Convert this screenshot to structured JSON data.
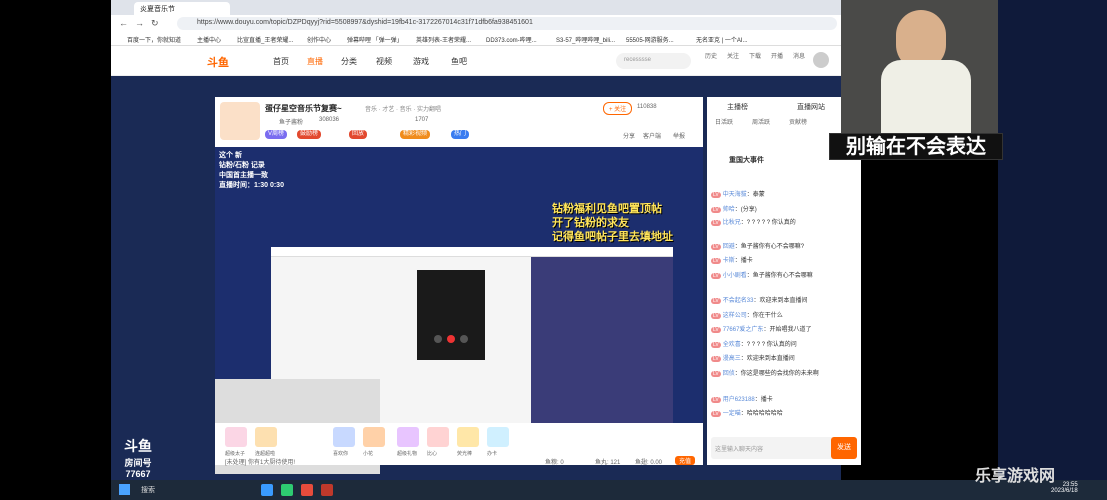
{
  "browser": {
    "tab_title": "炎夏音乐节",
    "url": "https://www.douyu.com/topic/DZPDqyyj?rid=5508997&dyshid=19fb41c-3172267014c31f71dfb6fa938451601",
    "bookmarks": [
      "百度一下，你就知道",
      "主播中心",
      "比宣直播_王者荣耀...",
      "创作中心",
      "弹幕哔哩 「弹一弹」",
      "英雄列表-王者荣耀...",
      "DD373.com-哔哩...",
      "S3-57_哔哩哔哩_bili...",
      "55505-网游服务...",
      "无名亚克 | 一个AI..."
    ]
  },
  "site": {
    "logo": "斗鱼",
    "nav": [
      "首页",
      "直播",
      "分类",
      "视频",
      "游戏",
      "鱼吧"
    ],
    "search_placeholder": "recesssse",
    "header_icons": [
      "历史",
      "关注",
      "下载",
      "开播",
      "消息"
    ]
  },
  "room": {
    "title": "蛋仔星空音乐节复赛~",
    "category": "音乐 · 才艺 · 音乐 · 实力翻唱",
    "follow_label": "+ 关注",
    "followers": "110838",
    "host_name": "鱼子酱粉",
    "hot": "308036",
    "id_label": "1707",
    "badges": [
      "V周榜",
      "鼓励榜",
      "回放",
      "精彩视频",
      "热门"
    ],
    "actions": [
      "分享",
      "客户端",
      "举报"
    ],
    "overlay_text": [
      "钻粉福利见鱼吧置顶帖",
      "开了钻粉的求友",
      "记得鱼吧帖子里去填地址"
    ],
    "left_overlay": [
      "这个 新",
      "钻粉/石粉 记录",
      "中国首主播一致",
      "直播时间：1:30 0:30"
    ],
    "room_number_label": "房间号",
    "room_number": "77667",
    "bottom_input_placeholder": "[未处理] 你有1大厨待使用!",
    "bottom_stats": [
      "鱼粮: 0",
      "鱼丸: 121",
      "鱼翅: 0.00"
    ],
    "recharge_label": "充值",
    "gift_labels": [
      "超级太子",
      "连超超啦",
      "喜欢你",
      "小花",
      "超级礼物",
      "比心",
      "荧光棒",
      "办卡"
    ]
  },
  "chat": {
    "tabs": [
      "主播榜",
      "直播网站"
    ],
    "subtabs": [
      "日活跃",
      "周活跃",
      "贡献榜"
    ],
    "event_title": "重国大事件",
    "messages": [
      {
        "user": "中天海拔",
        "text": "泰蒙"
      },
      {
        "user": "帅哈",
        "text": "(分享)"
      },
      {
        "user": "比秋兄",
        "text": "? ? ? ? ? 你认真的"
      },
      {
        "user": "回避",
        "text": "鱼子酱你有心不会哪嘛?"
      },
      {
        "user": "卡斯",
        "text": "播卡"
      },
      {
        "user": "小小剧看",
        "text": "鱼子酱你有心不会哪嘛"
      },
      {
        "user": "不会起名33",
        "text": "欢迎来到本直播间"
      },
      {
        "user": "这样公司",
        "text": "你在干什么"
      },
      {
        "user": "77667爱之广东",
        "text": "开始唱我八道了"
      },
      {
        "user": "全欢喜",
        "text": "? ? ? ? 你认真的问"
      },
      {
        "user": "漫高三",
        "text": "欢迎来到本直播间"
      },
      {
        "user": "回侦",
        "text": "你这是哪些的会找你的未来啊"
      },
      {
        "user": "用户623188",
        "text": "播卡"
      },
      {
        "user": "一定喵",
        "text": "哈哈哈哈哈哈"
      }
    ],
    "input_placeholder": "这里输入聊天内容",
    "send_label": "发送"
  },
  "caption": "别输在不会表达",
  "taskbar": {
    "search": "搜索",
    "time": "23:55",
    "date": "2023/6/18"
  },
  "watermark": "乐享游戏网"
}
